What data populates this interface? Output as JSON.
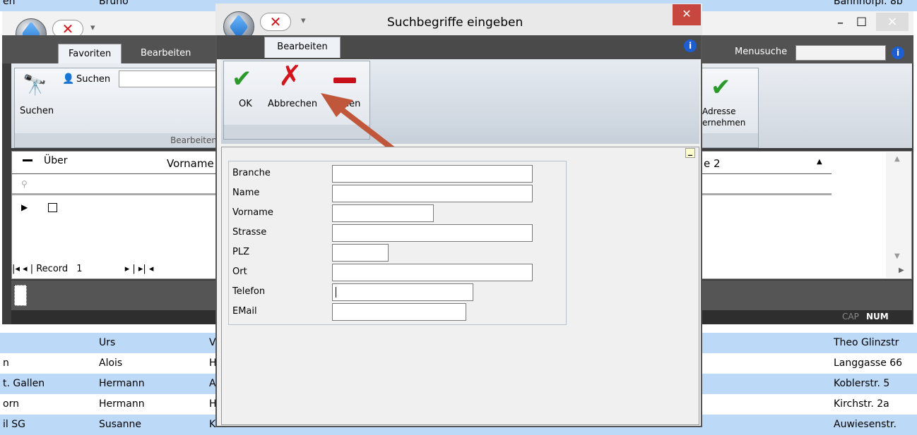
{
  "background_list": {
    "top_partial": {
      "col2": "Bruno",
      "col_last": "Bahnhofpl. 8b",
      "col1": "en"
    },
    "rows": [
      {
        "col1": "",
        "col2": "Urs",
        "col3": "V",
        "col_last": "Theo Glinzstr"
      },
      {
        "col1": "n",
        "col2": "Alois",
        "col3": "H",
        "col_last": "Langgasse 66"
      },
      {
        "col1": "t. Gallen",
        "col2": "Hermann",
        "col3": "A",
        "col_last": "Koblerstr. 5"
      },
      {
        "col1": "orn",
        "col2": "Hermann",
        "col3": "H",
        "col_last": "Kirchstr. 2a"
      },
      {
        "col1": "il SG",
        "col2": "Susanne",
        "col3": "K",
        "col_last": "Auwiesenstr."
      }
    ]
  },
  "main_window": {
    "tabs": [
      "Favoriten",
      "Bearbeiten"
    ],
    "menusuche_label": "Menusuche",
    "search_label": "Suchen",
    "search_button": "Suchen",
    "group_label": "Bearbeiten",
    "adresse_button": "Adresse\nernehmen",
    "grid": {
      "col_uber": "Über",
      "col_vorname": "Vorname",
      "col_e2": "e 2"
    },
    "navigator": {
      "record_label": "Record",
      "record_value": "1"
    },
    "status": {
      "cap": "CAP",
      "num": "NUM"
    },
    "window_controls": {
      "min": "–",
      "max": "□",
      "close": "×"
    }
  },
  "dialog": {
    "title": "Suchbegriffe eingeben",
    "tab": "Bearbeiten",
    "buttons": {
      "ok": "OK",
      "cancel": "Abbrechen",
      "third": "schen"
    },
    "fields": [
      {
        "label": "Branche",
        "value": ""
      },
      {
        "label": "Name",
        "value": ""
      },
      {
        "label": "Vorname",
        "value": ""
      },
      {
        "label": "Strasse",
        "value": ""
      },
      {
        "label": "PLZ",
        "value": ""
      },
      {
        "label": "Ort",
        "value": ""
      },
      {
        "label": "Telefon",
        "value": ""
      },
      {
        "label": "EMail",
        "value": ""
      }
    ]
  },
  "colors": {
    "row_blue": "#bcd9f7",
    "dark_chrome": "#3c3c3c",
    "close_red": "#c7463d",
    "annotation_arrow": "#c0573a"
  },
  "annotation": {
    "arrow": "pointing-to-cancel-button"
  }
}
